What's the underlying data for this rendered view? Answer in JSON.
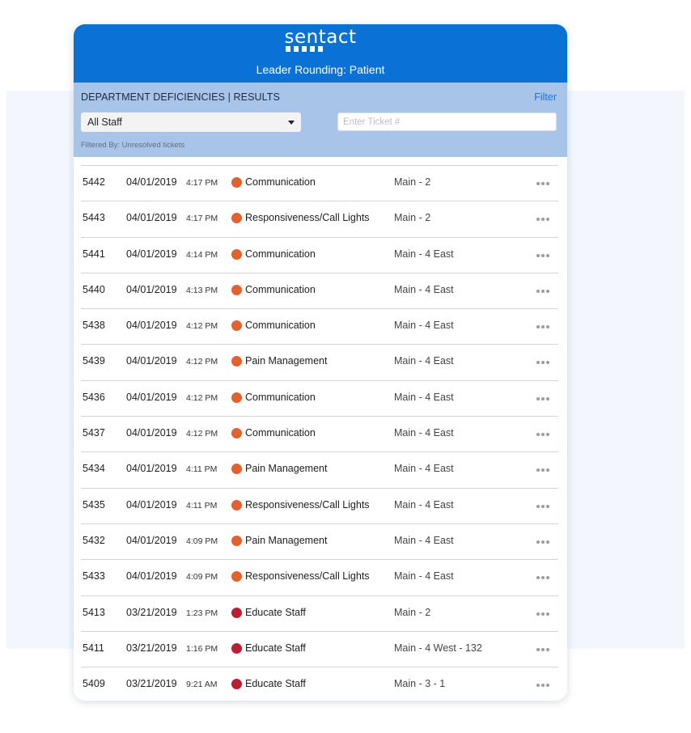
{
  "app": {
    "logo_text": "sentact",
    "title": "Leader Rounding: Patient",
    "brand_color": "#0a72d4"
  },
  "filter_bar": {
    "heading": "DEPARTMENT DEFICIENCIES | RESULTS",
    "filter_link": "Filter",
    "staff_select_value": "All Staff",
    "ticket_placeholder": "Enter Ticket #",
    "filtered_by": "Filtered By: Unresolved tickets"
  },
  "status_colors": {
    "orange": "#e2612e",
    "red": "#b81f33"
  },
  "tickets": [
    {
      "id": "5442",
      "date": "04/01/2019",
      "time": "4:17 PM",
      "status": "orange",
      "category": "Communication",
      "location": "Main - 2"
    },
    {
      "id": "5443",
      "date": "04/01/2019",
      "time": "4:17 PM",
      "status": "orange",
      "category": "Responsiveness/Call Lights",
      "location": "Main - 2"
    },
    {
      "id": "5441",
      "date": "04/01/2019",
      "time": "4:14 PM",
      "status": "orange",
      "category": "Communication",
      "location": "Main - 4 East"
    },
    {
      "id": "5440",
      "date": "04/01/2019",
      "time": "4:13 PM",
      "status": "orange",
      "category": "Communication",
      "location": "Main - 4 East"
    },
    {
      "id": "5438",
      "date": "04/01/2019",
      "time": "4:12 PM",
      "status": "orange",
      "category": "Communication",
      "location": "Main - 4 East"
    },
    {
      "id": "5439",
      "date": "04/01/2019",
      "time": "4:12 PM",
      "status": "orange",
      "category": "Pain Management",
      "location": "Main - 4 East"
    },
    {
      "id": "5436",
      "date": "04/01/2019",
      "time": "4:12 PM",
      "status": "orange",
      "category": "Communication",
      "location": "Main - 4 East"
    },
    {
      "id": "5437",
      "date": "04/01/2019",
      "time": "4:12 PM",
      "status": "orange",
      "category": "Communication",
      "location": "Main - 4 East"
    },
    {
      "id": "5434",
      "date": "04/01/2019",
      "time": "4:11 PM",
      "status": "orange",
      "category": "Pain Management",
      "location": "Main - 4 East"
    },
    {
      "id": "5435",
      "date": "04/01/2019",
      "time": "4:11 PM",
      "status": "orange",
      "category": "Responsiveness/Call Lights",
      "location": "Main - 4 East"
    },
    {
      "id": "5432",
      "date": "04/01/2019",
      "time": "4:09 PM",
      "status": "orange",
      "category": "Pain Management",
      "location": "Main - 4 East"
    },
    {
      "id": "5433",
      "date": "04/01/2019",
      "time": "4:09 PM",
      "status": "orange",
      "category": "Responsiveness/Call Lights",
      "location": "Main - 4 East"
    },
    {
      "id": "5413",
      "date": "03/21/2019",
      "time": "1:23 PM",
      "status": "red",
      "category": "Educate Staff",
      "location": "Main - 2"
    },
    {
      "id": "5411",
      "date": "03/21/2019",
      "time": "1:16 PM",
      "status": "red",
      "category": "Educate Staff",
      "location": "Main - 4 West - 132"
    },
    {
      "id": "5409",
      "date": "03/21/2019",
      "time": "9:21 AM",
      "status": "red",
      "category": "Educate Staff",
      "location": "Main - 3 - 1"
    }
  ]
}
